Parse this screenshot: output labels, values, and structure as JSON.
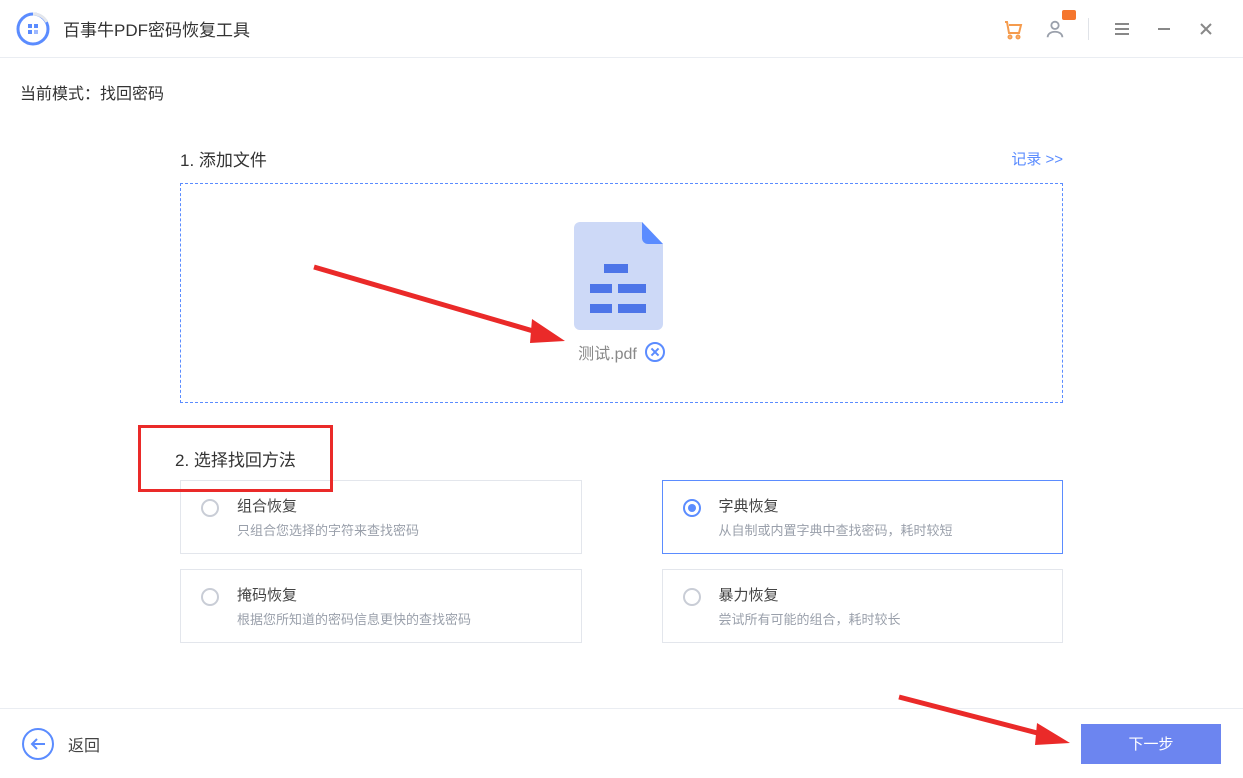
{
  "app": {
    "title": "百事牛PDF密码恢复工具"
  },
  "mode": {
    "label": "当前模式：",
    "value": "找回密码"
  },
  "section1": {
    "title": "1. 添加文件",
    "records_link": "记录 >>"
  },
  "file": {
    "name": "测试.pdf"
  },
  "section2": {
    "title": "2. 选择找回方法"
  },
  "options": [
    {
      "title": "组合恢复",
      "desc": "只组合您选择的字符来查找密码",
      "selected": false
    },
    {
      "title": "字典恢复",
      "desc": "从自制或内置字典中查找密码，耗时较短",
      "selected": true
    },
    {
      "title": "掩码恢复",
      "desc": "根据您所知道的密码信息更快的查找密码",
      "selected": false
    },
    {
      "title": "暴力恢复",
      "desc": "尝试所有可能的组合，耗时较长",
      "selected": false
    }
  ],
  "footer": {
    "back": "返回",
    "next": "下一步"
  },
  "colors": {
    "primary": "#5b8cff",
    "accent": "#ea2a29",
    "cart": "#f59b4d"
  }
}
